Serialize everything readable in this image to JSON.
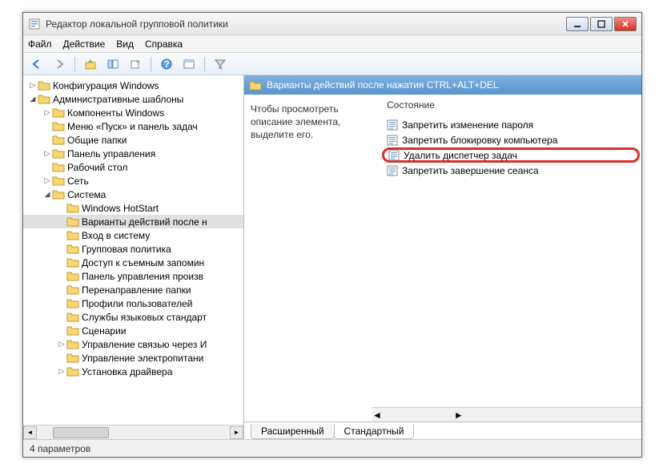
{
  "window": {
    "title": "Редактор локальной групповой политики"
  },
  "menu": {
    "file": "Файл",
    "action": "Действие",
    "view": "Вид",
    "help": "Справка"
  },
  "tree": {
    "items": [
      {
        "indent": 0,
        "exp": "▷",
        "label": "Конфигурация Windows"
      },
      {
        "indent": 0,
        "exp": "◢",
        "label": "Административные шаблоны"
      },
      {
        "indent": 1,
        "exp": "▷",
        "label": "Компоненты Windows"
      },
      {
        "indent": 1,
        "exp": "",
        "label": "Меню «Пуск» и панель задач"
      },
      {
        "indent": 1,
        "exp": "",
        "label": "Общие папки"
      },
      {
        "indent": 1,
        "exp": "▷",
        "label": "Панель управления"
      },
      {
        "indent": 1,
        "exp": "",
        "label": "Рабочий стол"
      },
      {
        "indent": 1,
        "exp": "▷",
        "label": "Сеть"
      },
      {
        "indent": 1,
        "exp": "◢",
        "label": "Система"
      },
      {
        "indent": 2,
        "exp": "",
        "label": "Windows HotStart"
      },
      {
        "indent": 2,
        "exp": "",
        "label": "Варианты действий после н",
        "selected": true
      },
      {
        "indent": 2,
        "exp": "",
        "label": "Вход в систему"
      },
      {
        "indent": 2,
        "exp": "",
        "label": "Групповая политика"
      },
      {
        "indent": 2,
        "exp": "",
        "label": "Доступ к съемным запомин"
      },
      {
        "indent": 2,
        "exp": "",
        "label": "Панель управления произв"
      },
      {
        "indent": 2,
        "exp": "",
        "label": "Перенаправление папки"
      },
      {
        "indent": 2,
        "exp": "",
        "label": "Профили пользователей"
      },
      {
        "indent": 2,
        "exp": "",
        "label": "Службы языковых стандарт"
      },
      {
        "indent": 2,
        "exp": "",
        "label": "Сценарии"
      },
      {
        "indent": 2,
        "exp": "▷",
        "label": "Управление связью через И"
      },
      {
        "indent": 2,
        "exp": "",
        "label": "Управление электропитани"
      },
      {
        "indent": 2,
        "exp": "▷",
        "label": "Установка драйвера"
      }
    ]
  },
  "detail": {
    "header": "Варианты действий после нажатия CTRL+ALT+DEL",
    "desc": "Чтобы просмотреть описание элемента, выделите его.",
    "stateHeader": "Состояние",
    "items": [
      {
        "label": "Запретить изменение пароля",
        "hl": false
      },
      {
        "label": "Запретить блокировку компьютера",
        "hl": false
      },
      {
        "label": "Удалить диспетчер задач",
        "hl": true
      },
      {
        "label": "Запретить завершение сеанса",
        "hl": false
      }
    ]
  },
  "tabs": {
    "extended": "Расширенный",
    "standard": "Стандартный"
  },
  "status": {
    "text": "4 параметров"
  }
}
